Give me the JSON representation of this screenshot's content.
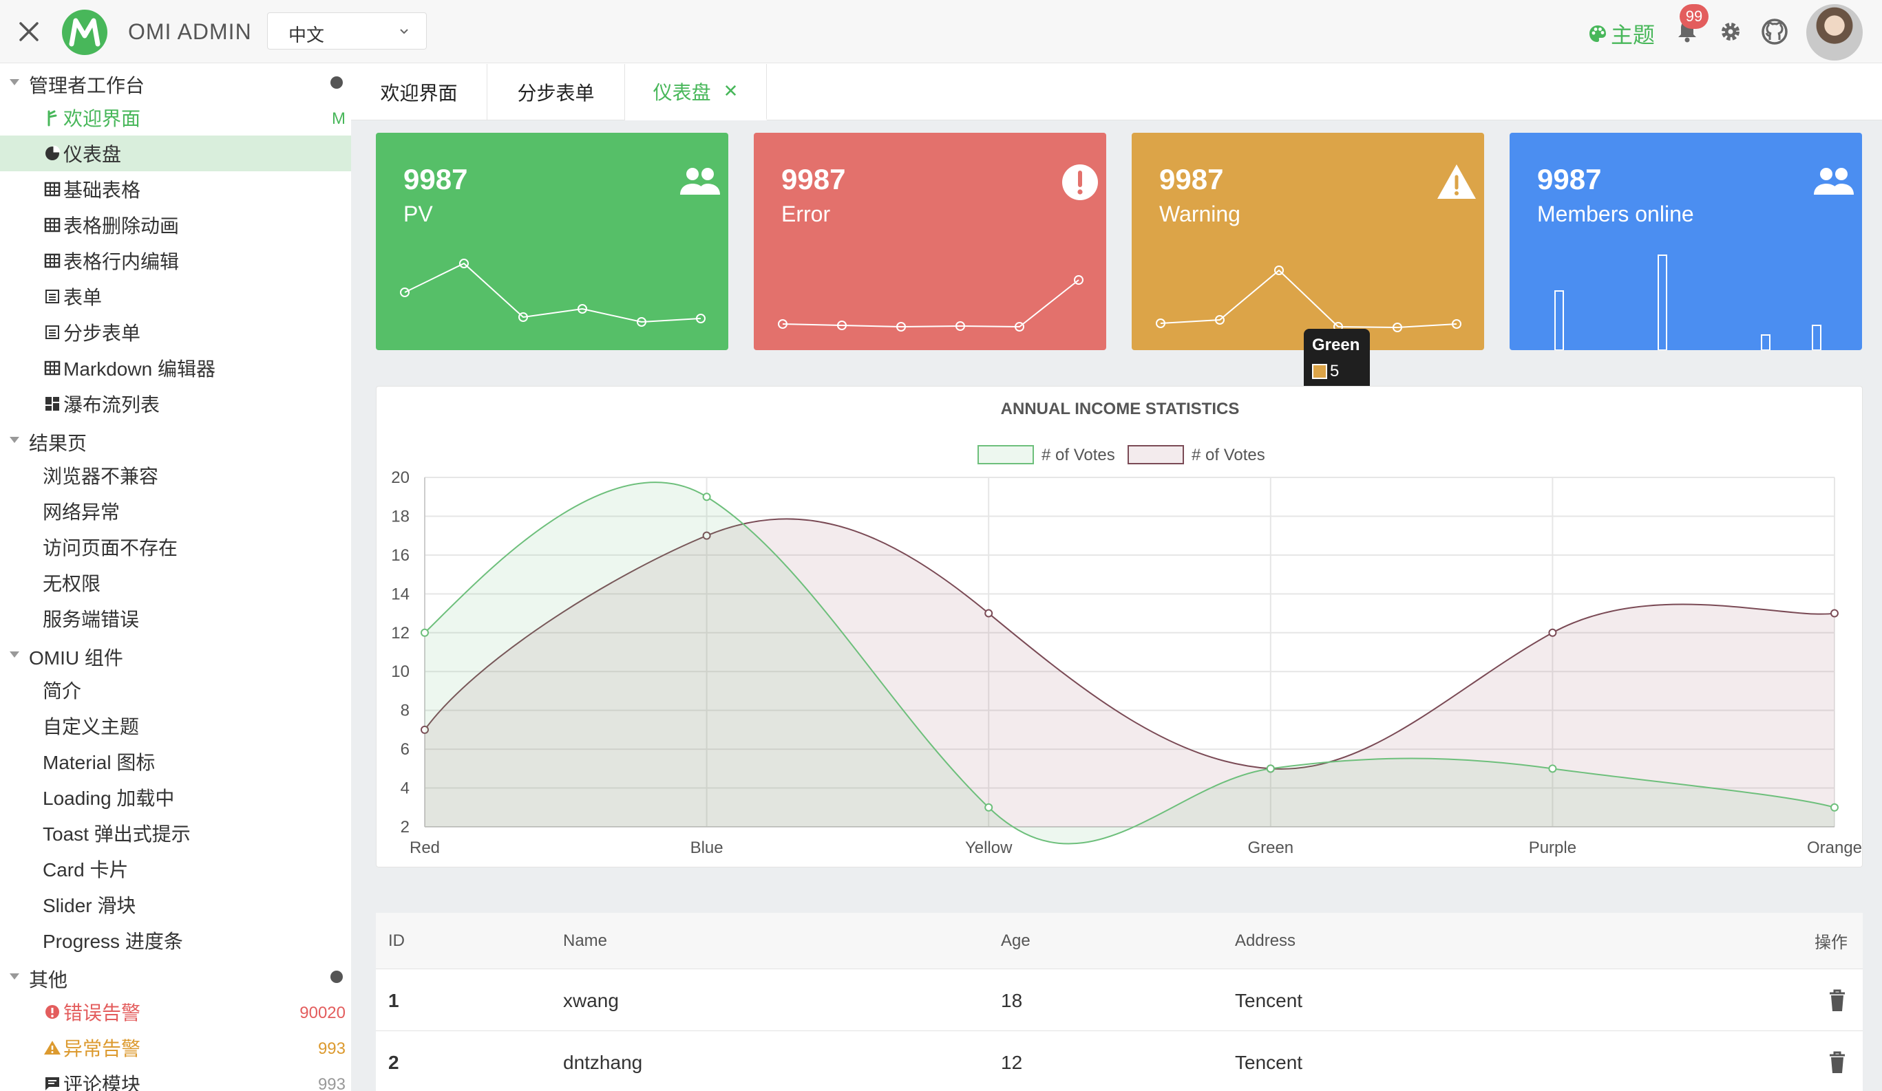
{
  "header": {
    "app_title": "OMI ADMIN",
    "lang_value": "中文",
    "theme_label": "主题",
    "notif_count": "99"
  },
  "sidebar": {
    "groups": [
      {
        "label": "管理者工作台",
        "items": [
          {
            "label": "欢迎界面",
            "meta": "M",
            "icon": "tree-icon"
          },
          {
            "label": "仪表盘",
            "icon": "pie-chart-icon"
          },
          {
            "label": "基础表格",
            "icon": "grid-table-icon"
          },
          {
            "label": "表格删除动画",
            "icon": "grid-table-icon"
          },
          {
            "label": "表格行内编辑",
            "icon": "grid-table-icon"
          },
          {
            "label": "表单",
            "icon": "form-icon"
          },
          {
            "label": "分步表单",
            "icon": "form-icon"
          },
          {
            "label": "Markdown 编辑器",
            "icon": "grid-table-icon"
          },
          {
            "label": "瀑布流列表",
            "icon": "dashboard-grid-icon"
          }
        ]
      },
      {
        "label": "结果页",
        "items": [
          {
            "label": "浏览器不兼容"
          },
          {
            "label": "网络异常"
          },
          {
            "label": "访问页面不存在"
          },
          {
            "label": "无权限"
          },
          {
            "label": "服务端错误"
          }
        ]
      },
      {
        "label": "OMIU 组件",
        "items": [
          {
            "label": "简介"
          },
          {
            "label": "自定义主题"
          },
          {
            "label": "Material 图标"
          },
          {
            "label": "Loading 加载中"
          },
          {
            "label": "Toast 弹出式提示"
          },
          {
            "label": "Card 卡片"
          },
          {
            "label": "Slider 滑块"
          },
          {
            "label": "Progress 进度条"
          }
        ]
      },
      {
        "label": "其他",
        "items": [
          {
            "label": "错误告警",
            "meta": "90020",
            "icon": "error-icon"
          },
          {
            "label": "异常告警",
            "meta": "993",
            "icon": "warning-icon"
          },
          {
            "label": "评论模块",
            "meta": "993",
            "icon": "comment-icon"
          }
        ]
      }
    ]
  },
  "tabs": [
    {
      "label": "欢迎界面"
    },
    {
      "label": "分步表单"
    },
    {
      "label": "仪表盘"
    }
  ],
  "cards": [
    {
      "number": "9987",
      "label": "PV",
      "color": "#56bf68"
    },
    {
      "number": "9987",
      "label": "Error",
      "color": "#e3716c"
    },
    {
      "number": "9987",
      "label": "Warning",
      "color": "#dca448"
    },
    {
      "number": "9987",
      "label": "Members online",
      "color": "#4b8ef1"
    }
  ],
  "tooltip": {
    "title": "Green",
    "value": "5"
  },
  "chart_data": {
    "type": "line",
    "title": "ANNUAL INCOME STATISTICS",
    "categories": [
      "Red",
      "Blue",
      "Yellow",
      "Green",
      "Purple",
      "Orange"
    ],
    "series": [
      {
        "name": "# of Votes",
        "values": [
          12,
          19,
          3,
          5,
          5,
          3
        ],
        "color": "#6dbf7b"
      },
      {
        "name": "# of Votes",
        "values": [
          7,
          17,
          13,
          5,
          12,
          13
        ],
        "color": "#7a4a55"
      }
    ],
    "yticks": [
      "20",
      "18",
      "16",
      "14",
      "12",
      "10",
      "8",
      "6",
      "4",
      "2"
    ],
    "ylim": [
      2,
      20
    ],
    "grid": true,
    "legend": "top"
  },
  "table": {
    "headers": [
      "ID",
      "Name",
      "Age",
      "Address",
      "操作"
    ],
    "rows": [
      {
        "id": "1",
        "name": "xwang",
        "age": "18",
        "address": "Tencent"
      },
      {
        "id": "2",
        "name": "dntzhang",
        "age": "12",
        "address": "Tencent"
      }
    ]
  }
}
